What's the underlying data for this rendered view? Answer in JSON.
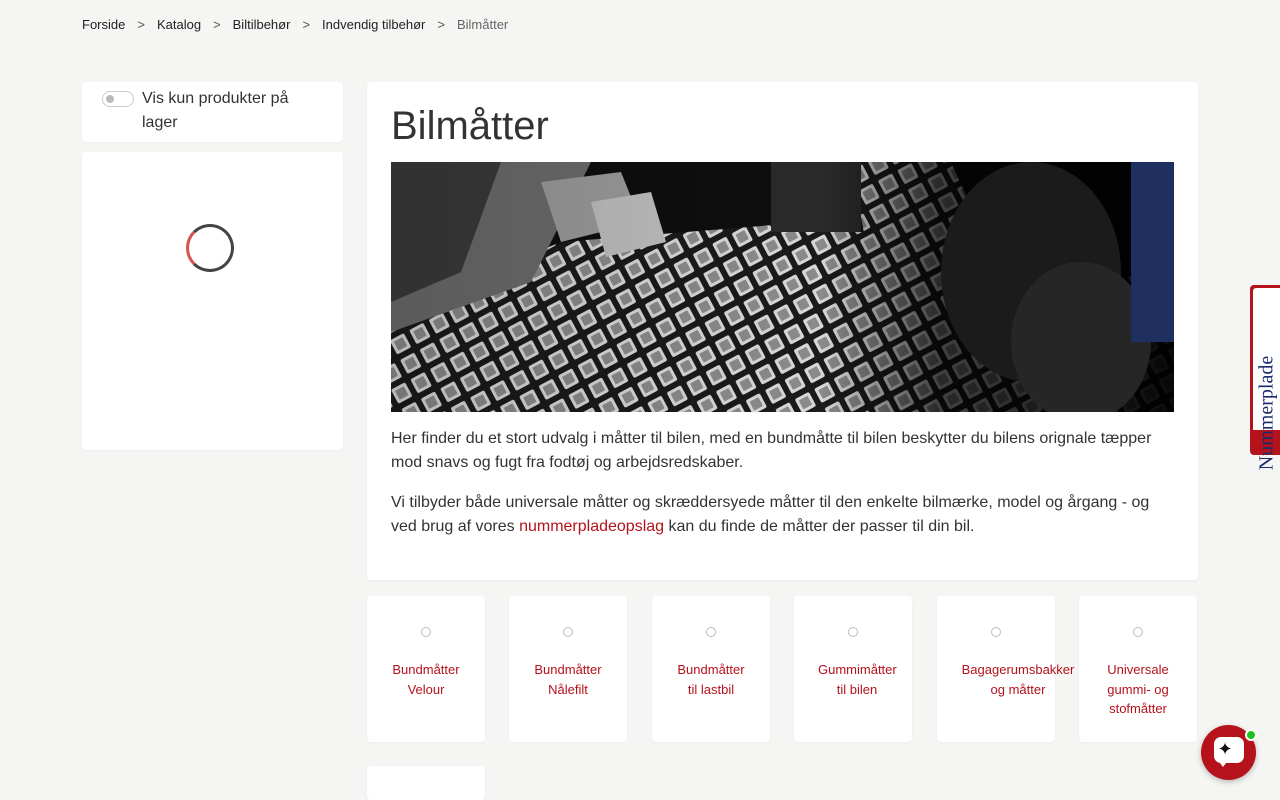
{
  "breadcrumb": {
    "items": [
      "Forside",
      "Katalog",
      "Biltilbehør",
      "Indvendig tilbehør"
    ],
    "current": "Bilmåtter",
    "separator": ">"
  },
  "filters": {
    "in_stock_label": "Vis kun produkter på lager",
    "in_stock_enabled": false
  },
  "main": {
    "title": "Bilmåtter",
    "paragraph1": "Her finder du et stort udvalg i måtter til bilen, med en bundmåtte til bilen beskytter du bilens orignale tæpper mod snavs og fugt fra fodtøj og arbejdsredskaber.",
    "paragraph2_before": "Vi tilbyder både universale måtter og skræddersyede måtter til den enkelte bilmærke, model og årgang - og ved brug af vores ",
    "paragraph2_link": "nummerpladeopslag",
    "paragraph2_after": " kan du finde de måtter der passer til din bil."
  },
  "categories": [
    {
      "label": "Bundmåtter Velour"
    },
    {
      "label": "Bundmåtter Nålefilt"
    },
    {
      "label": "Bundmåtter til lastbil"
    },
    {
      "label": "Gummimåtter til bilen"
    },
    {
      "label": "Bagagerumsbakker og måtter"
    },
    {
      "label": "Universale gummi- og stofmåtter"
    }
  ],
  "side_tab": {
    "label": "Nummerplade"
  },
  "chat": {
    "icon": "sparkle-chat-icon",
    "status": "online"
  },
  "colors": {
    "accent": "#b5121b",
    "background": "#f5f5f3",
    "online": "#1ec11e"
  }
}
